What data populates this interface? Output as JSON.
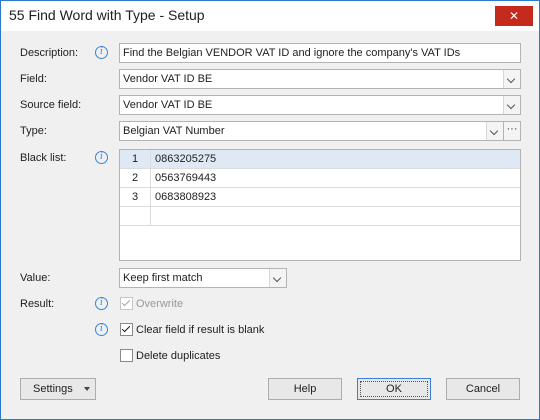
{
  "window": {
    "title": "55 Find Word with Type - Setup",
    "close_icon": "✕"
  },
  "form": {
    "description": {
      "label": "Description:",
      "value": "Find the Belgian VENDOR VAT ID and ignore the company's VAT IDs"
    },
    "field": {
      "label": "Field:",
      "value": "Vendor VAT ID BE"
    },
    "source_field": {
      "label": "Source field:",
      "value": "Vendor VAT ID BE"
    },
    "type": {
      "label": "Type:",
      "value": "Belgian VAT Number",
      "more_label": "···"
    },
    "black_list": {
      "label": "Black list:",
      "rows": [
        {
          "num": "1",
          "value": "0863205275"
        },
        {
          "num": "2",
          "value": "0563769443"
        },
        {
          "num": "3",
          "value": "0683808923"
        }
      ]
    },
    "value": {
      "label": "Value:",
      "selected": "Keep first match"
    },
    "result": {
      "label": "Result:"
    },
    "overwrite": {
      "label": "Overwrite",
      "checked": true,
      "enabled": false
    },
    "clear_field": {
      "label": "Clear field if result is blank",
      "checked": true
    },
    "delete_duplicates": {
      "label": "Delete duplicates",
      "checked": false
    },
    "info_icon": "i"
  },
  "buttons": {
    "settings": "Settings",
    "help": "Help",
    "ok": "OK",
    "cancel": "Cancel"
  },
  "colors": {
    "accent": "#2b79c9",
    "close": "#c42b1c",
    "selected_row": "#dfe9f5"
  }
}
